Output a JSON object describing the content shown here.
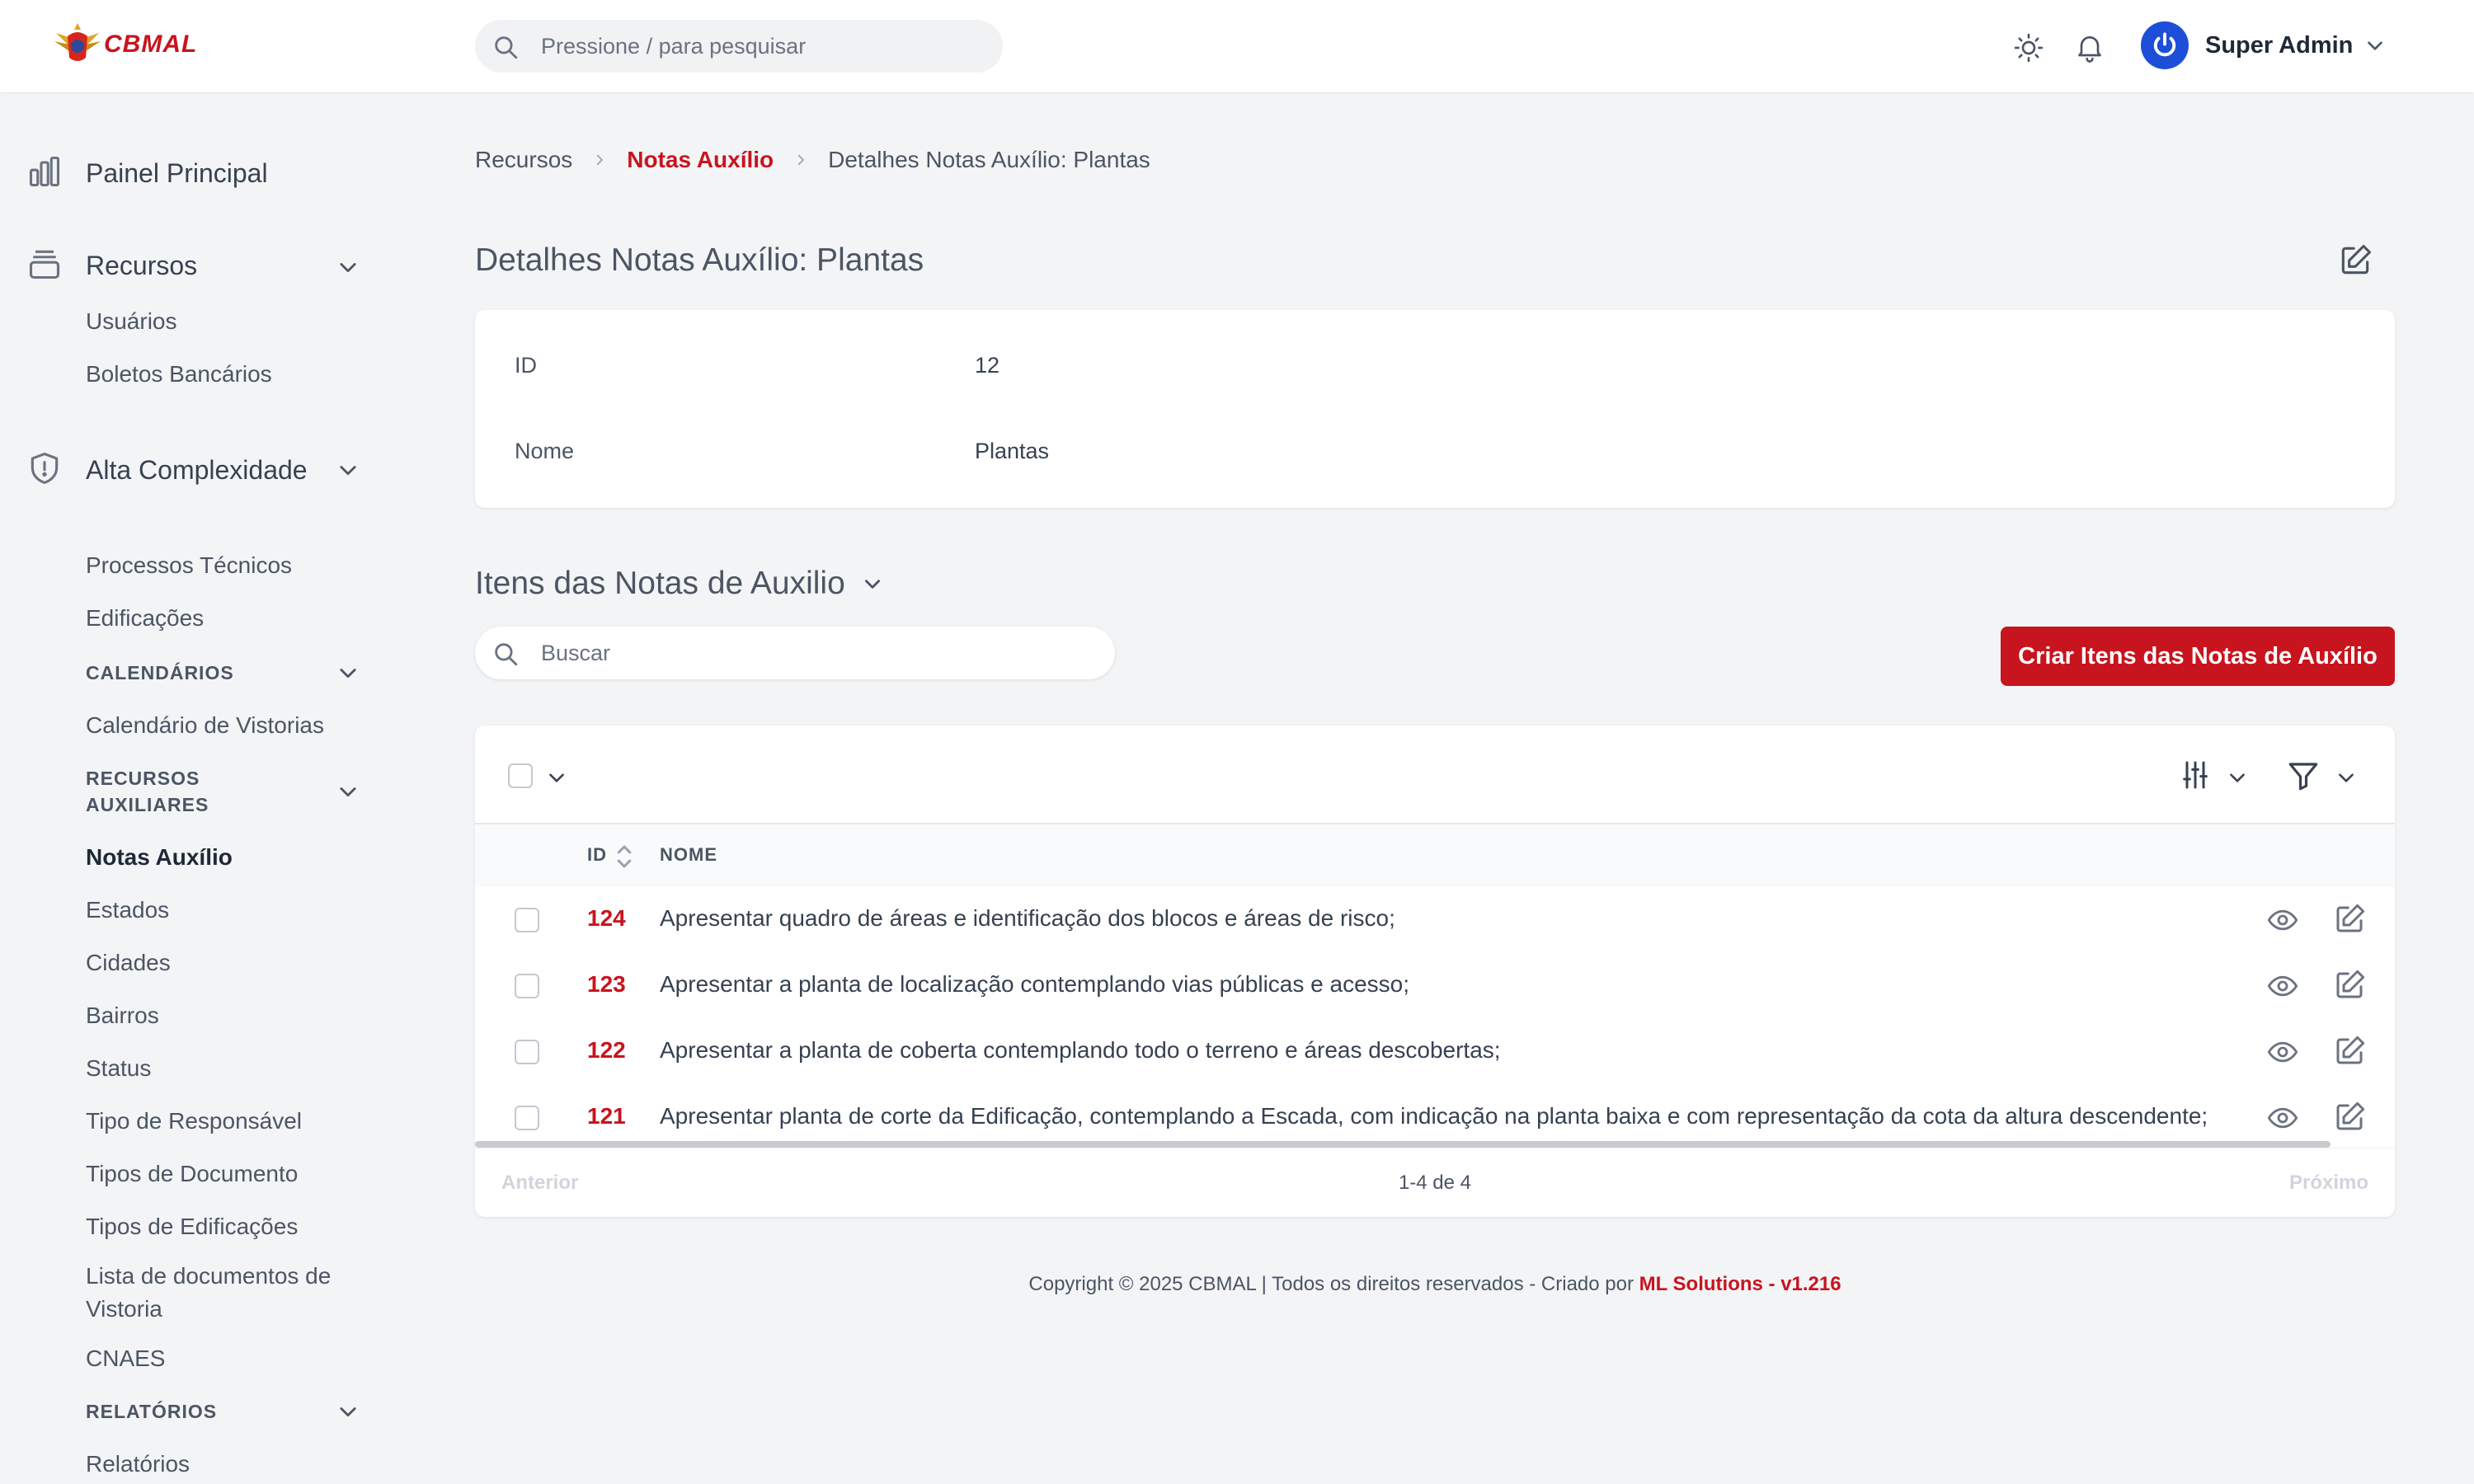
{
  "brand": {
    "logo_text": "CBMAL"
  },
  "colors": {
    "accent": "#c8141e",
    "avatar": "#1d4ed8",
    "background": "#f3f4f6"
  },
  "topbar": {
    "search_placeholder": "Pressione / para pesquisar",
    "user_name": "Super Admin",
    "icons": [
      "search-icon",
      "sun-icon",
      "bell-icon",
      "power-icon",
      "chevron-down-icon"
    ]
  },
  "sidebar": {
    "dashboard": "Painel Principal",
    "resources": "Recursos",
    "users": "Usuários",
    "bank_slips": "Boletos Bancários",
    "high_complexity": "Alta Complexidade",
    "technical_processes": "Processos Técnicos",
    "buildings": "Edificações",
    "calendars_section": "CALENDÁRIOS",
    "inspection_calendar": "Calendário de Vistorias",
    "aux_resources_section": "RECURSOS AUXILIARES",
    "aux_notes": "Notas Auxílio",
    "states": "Estados",
    "cities": "Cidades",
    "districts": "Bairros",
    "status": "Status",
    "responsible_type": "Tipo de Responsável",
    "document_types": "Tipos de Documento",
    "building_types": "Tipos de Edificações",
    "inspection_docs": "Lista de documentos de Vistoria",
    "cnaes": "CNAES",
    "reports_section": "RELATÓRIOS",
    "reports": "Relatórios"
  },
  "breadcrumb": [
    "Recursos",
    "Notas Auxílio",
    "Detalhes Notas Auxílio: Plantas"
  ],
  "page": {
    "title": "Detalhes Notas Auxílio: Plantas",
    "details": [
      {
        "label": "ID",
        "value": "12"
      },
      {
        "label": "Nome",
        "value": "Plantas"
      }
    ]
  },
  "items_section": {
    "title": "Itens das Notas de Auxilio",
    "search_placeholder": "Buscar",
    "create_button": "Criar Itens das Notas de Auxílio",
    "columns": [
      "ID",
      "NOME"
    ],
    "rows": [
      {
        "id": "124",
        "name": "Apresentar quadro de áreas e identificação dos blocos e áreas de risco;"
      },
      {
        "id": "123",
        "name": "Apresentar a planta de localização contemplando vias públicas e acesso;"
      },
      {
        "id": "122",
        "name": "Apresentar a planta de coberta contemplando todo o terreno e áreas descobertas;"
      },
      {
        "id": "121",
        "name": "Apresentar planta de corte da Edificação, contemplando a Escada, com indicação na planta baixa e com representação da cota da altura descendente;"
      }
    ],
    "pagination": {
      "prev": "Anterior",
      "count": "1-4 de 4",
      "next": "Próximo"
    }
  },
  "footer": {
    "text": "Copyright © 2025 CBMAL | Todos os direitos reservados - Criado por ",
    "brand": "ML Solutions - v1.216"
  }
}
